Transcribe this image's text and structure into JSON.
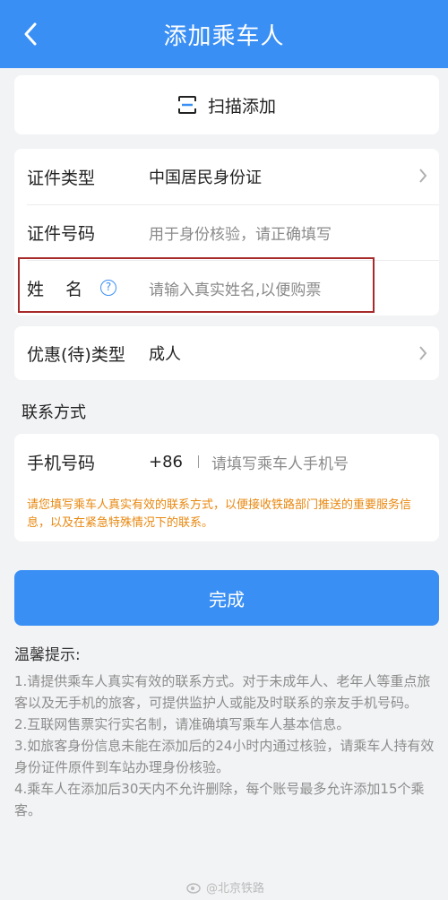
{
  "header": {
    "title": "添加乘车人"
  },
  "scan": {
    "label": "扫描添加"
  },
  "form": {
    "id_type": {
      "label": "证件类型",
      "value": "中国居民身份证"
    },
    "id_number": {
      "label": "证件号码",
      "placeholder": "用于身份核验，请正确填写"
    },
    "name": {
      "label": "姓    名",
      "placeholder": "请输入真实姓名,以便购票"
    },
    "discount": {
      "label": "优惠(待)类型",
      "value": "成人"
    }
  },
  "contact": {
    "section_title": "联系方式",
    "phone_label": "手机号码",
    "prefix": "+86",
    "phone_placeholder": "请填写乘车人手机号",
    "notice": "请您填写乘车人真实有效的联系方式，以便接收铁路部门推送的重要服务信息，以及在紧急特殊情况下的联系。"
  },
  "done_label": "完成",
  "tips": {
    "title": "温馨提示:",
    "items": [
      "1.请提供乘车人真实有效的联系方式。对于未成年人、老年人等重点旅客以及无手机的旅客，可提供监护人或能及时联系的亲友手机号码。",
      "2.互联网售票实行实名制，请准确填写乘车人基本信息。",
      "3.如旅客身份信息未能在添加后的24小时内通过核验，请乘车人持有效身份证件原件到车站办理身份核验。",
      "4.乘车人在添加后30天内不允许删除，每个账号最多允许添加15个乘客。"
    ]
  },
  "watermark": "@北京铁路",
  "colors": {
    "brand": "#3a8ff5",
    "notice": "#e8870e",
    "highlight": "#a72a2a"
  }
}
